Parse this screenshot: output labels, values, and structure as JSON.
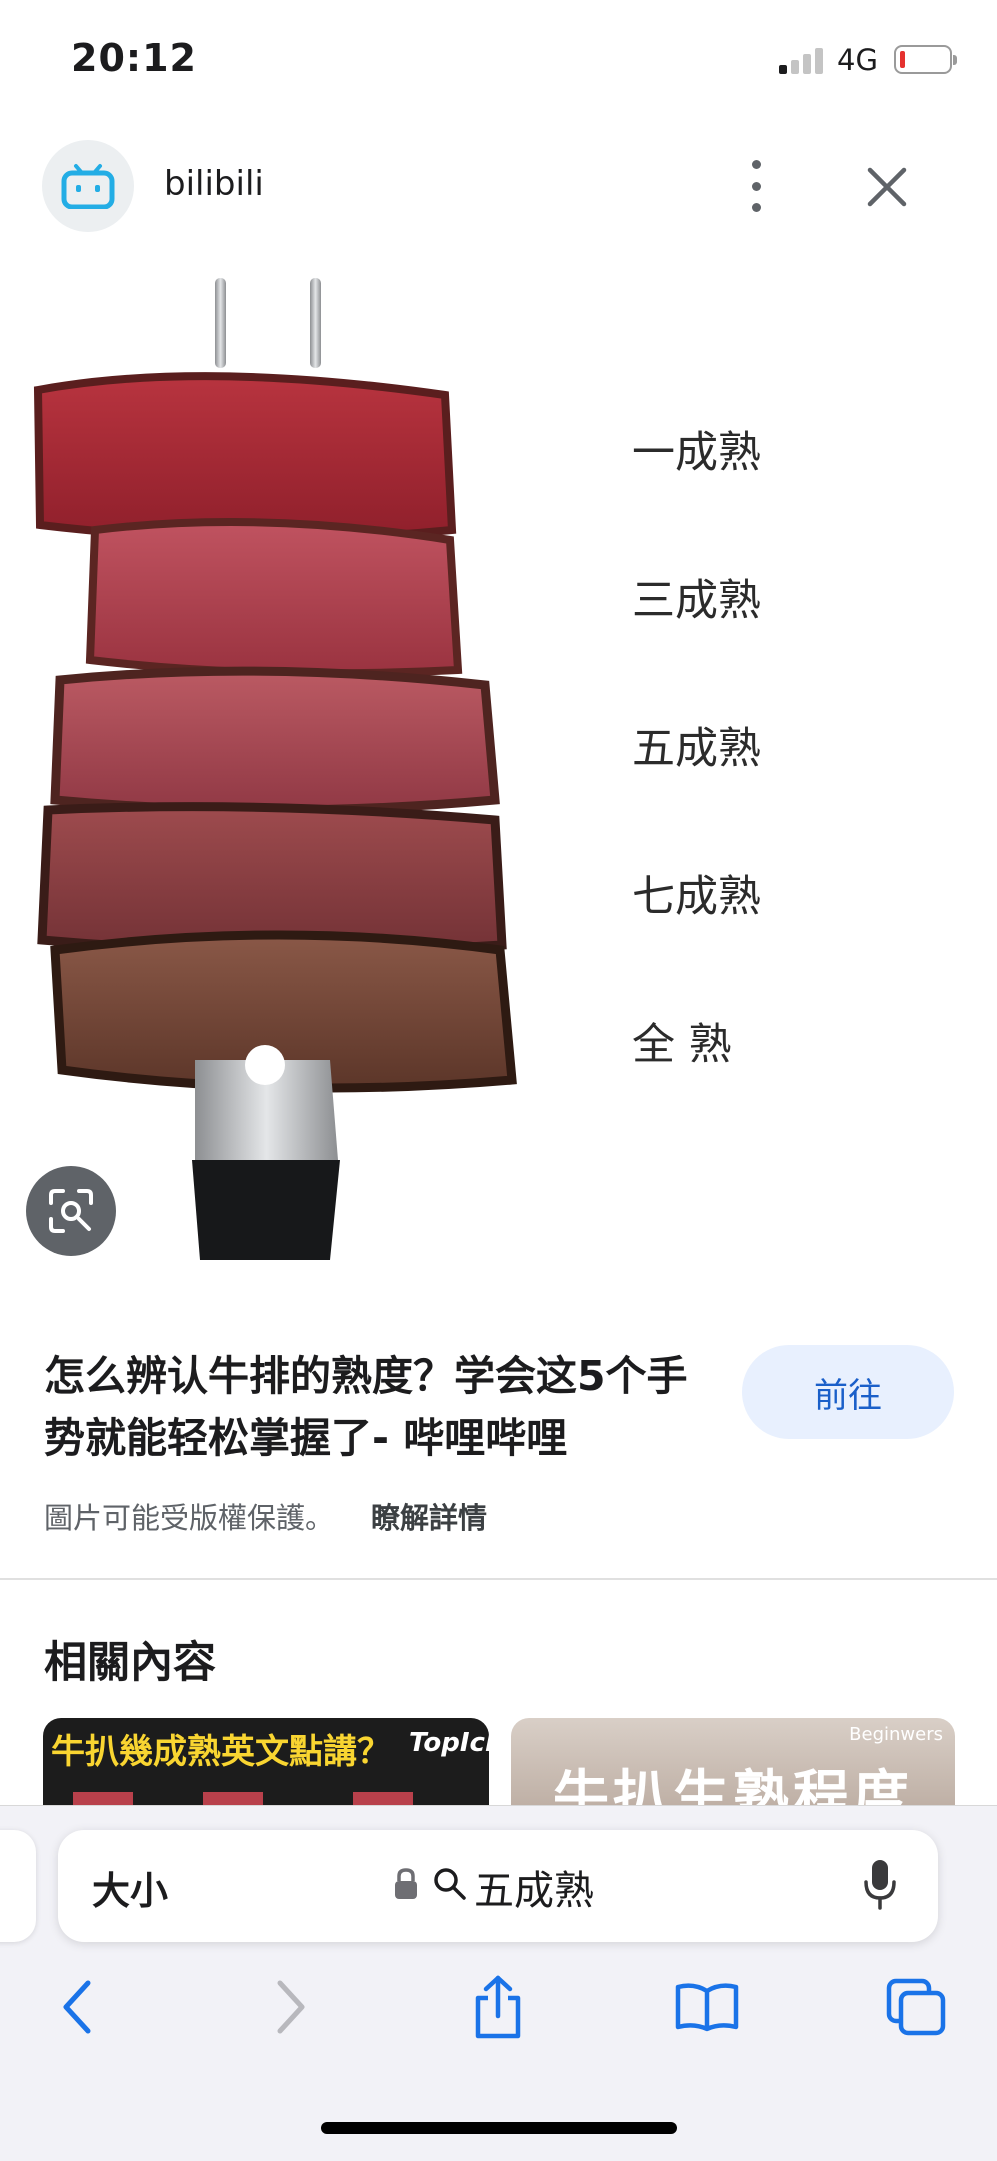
{
  "status_bar": {
    "time": "20:12",
    "network": "4G",
    "battery_color": "#e5312f"
  },
  "header": {
    "source_name": "bilibili",
    "logo_color": "#23ade5"
  },
  "image": {
    "doneness_labels": [
      "一成熟",
      "三成熟",
      "五成熟",
      "七成熟",
      "全 熟"
    ]
  },
  "result": {
    "title": "怎么辨认牛排的熟度？学会这5个手势就能轻松掌握了- 哔哩哔哩",
    "visit_label": "前往",
    "copyright_notice": "圖片可能受版權保護。",
    "learn_more": "瞭解詳情"
  },
  "related": {
    "heading": "相關內容",
    "thumbs": [
      {
        "caption": "牛扒幾成熟英文點講？",
        "logo": "TopIck"
      },
      {
        "caption": "牛扒生熟程度",
        "logo": "Beginwers"
      }
    ]
  },
  "browser": {
    "text_size_label": "大小",
    "query": "五成熟"
  },
  "colors": {
    "accent": "#1a5fc9",
    "toolbar_icon": "#1a73e8"
  }
}
